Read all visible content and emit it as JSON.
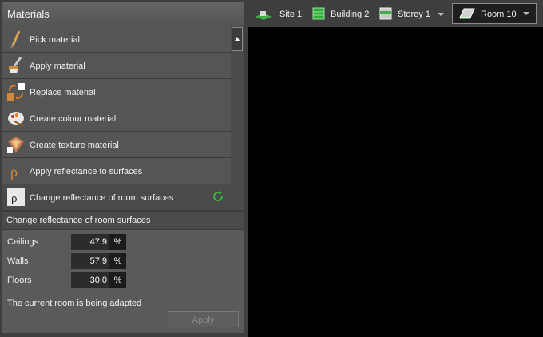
{
  "materials": {
    "title": "Materials",
    "items": [
      {
        "label": "Pick material",
        "icon": "pick-material-icon"
      },
      {
        "label": "Apply material",
        "icon": "apply-material-icon"
      },
      {
        "label": "Replace material",
        "icon": "replace-material-icon"
      },
      {
        "label": "Create colour material",
        "icon": "colour-palette-icon"
      },
      {
        "label": "Create texture material",
        "icon": "texture-material-icon"
      },
      {
        "label": "Apply reflectance to surfaces",
        "icon": "reflectance-icon"
      },
      {
        "label": "Change reflectance of room surfaces",
        "icon": "room-reflectance-icon"
      }
    ]
  },
  "properties": {
    "title": "Change reflectance of room surfaces",
    "rows": [
      {
        "label": "Ceilings",
        "value": "47.9",
        "unit": "%"
      },
      {
        "label": "Walls",
        "value": "57.9",
        "unit": "%"
      },
      {
        "label": "Floors",
        "value": "30.0",
        "unit": "%"
      }
    ],
    "status": "The current room is being adapted",
    "apply_label": "Apply"
  },
  "breadcrumb": [
    {
      "label": "Site 1",
      "icon": "site-icon"
    },
    {
      "label": "Building 2",
      "icon": "building-icon"
    },
    {
      "label": "Storey 1",
      "icon": "storey-icon"
    },
    {
      "label": "Room 10",
      "icon": "room-icon"
    }
  ]
}
